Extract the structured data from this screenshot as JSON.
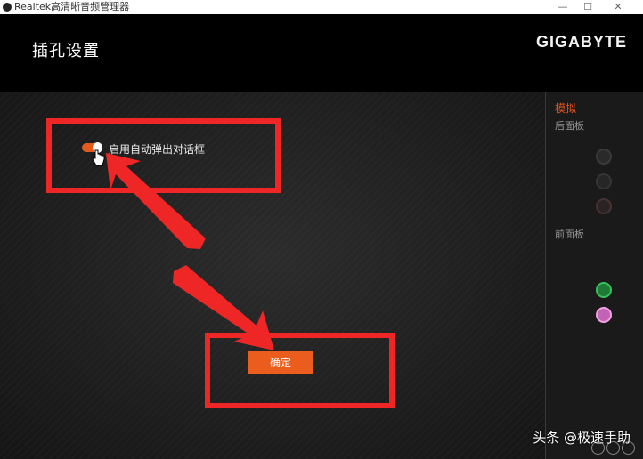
{
  "window": {
    "title": "Realtek高清晰音频管理器",
    "minimize_glyph": "—",
    "maximize_glyph": "☐",
    "close_glyph": "✕"
  },
  "header": {
    "page_title": "插孔设置",
    "brand": "GIGABYTE"
  },
  "settings": {
    "toggle_label": "启用自动弹出对话框",
    "toggle_on": true,
    "ok_label": "确定"
  },
  "sidebar": {
    "section_title": "模拟",
    "rear_label": "后面板",
    "front_label": "前面板",
    "jack_colors": {
      "rear_1": "#3a3a3a",
      "rear_2": "#333333",
      "rear_3": "#4a3a3a",
      "front_green": "#2fa84f",
      "front_pink": "#e07bd0"
    }
  },
  "watermark": "头条 @极速手助",
  "colors": {
    "accent": "#e55a1c",
    "highlight": "#ee2626"
  }
}
